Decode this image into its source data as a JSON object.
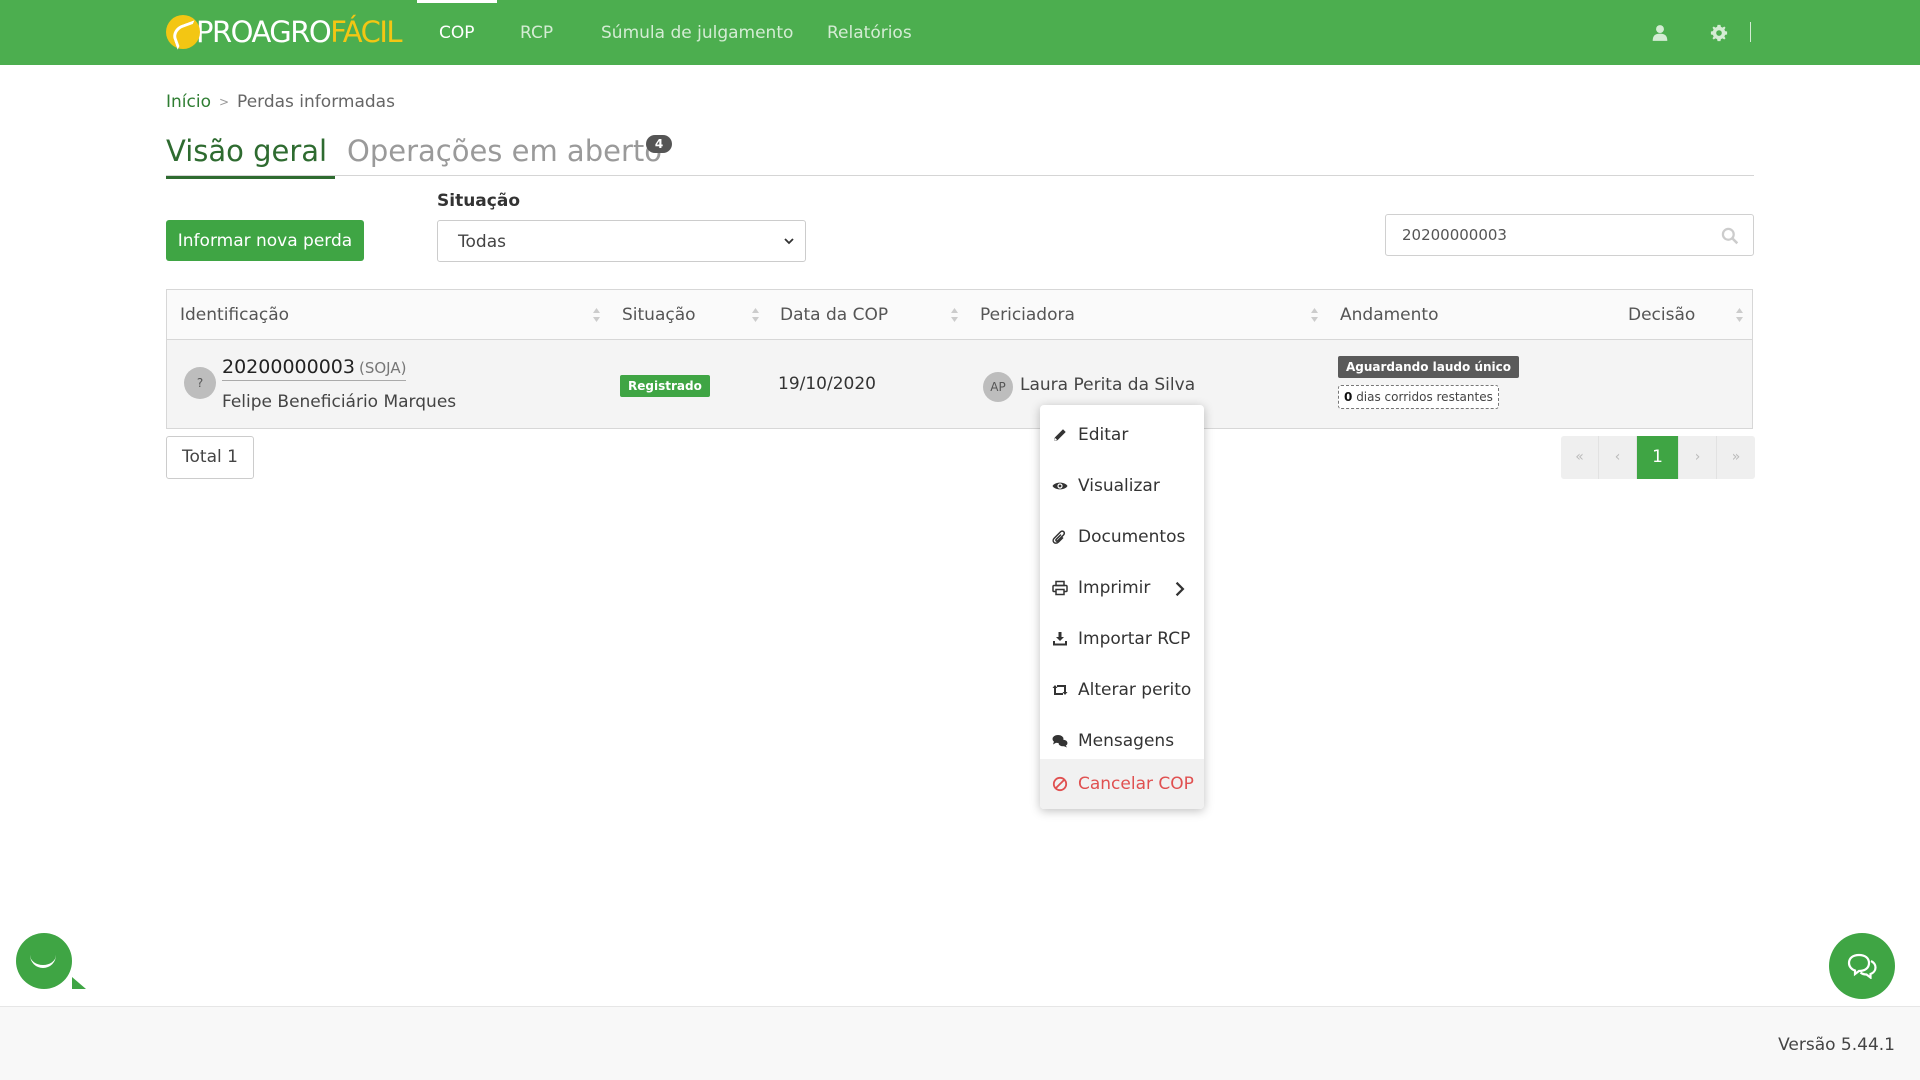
{
  "app": {
    "logo_part1": "PROAGRO",
    "logo_part2": "FÁCIL",
    "brand_color": "#4cae4f",
    "accent_color": "#f3c613"
  },
  "nav": {
    "items": [
      {
        "label": "COP",
        "active": true
      },
      {
        "label": "RCP",
        "active": false
      },
      {
        "label": "Súmula de julgamento",
        "active": false
      },
      {
        "label": "Relatórios",
        "active": false
      }
    ],
    "icons": [
      "user-icon",
      "gear-icon"
    ]
  },
  "breadcrumb": {
    "home": "Início",
    "current": "Perdas informadas"
  },
  "tabs": {
    "overview": "Visão geral",
    "open_ops": "Operações em aberto",
    "open_ops_count": "4"
  },
  "filters": {
    "new_button": "Informar nova perda",
    "status_label": "Situação",
    "status_value": "Todas",
    "search_value": "20200000003"
  },
  "table": {
    "headers": [
      "Identificação",
      "Situação",
      "Data da COP",
      "Periciadora",
      "Andamento",
      "Decisão"
    ],
    "row": {
      "avatar": "?",
      "id": "20200000003",
      "crop": "(SOJA)",
      "beneficiary": "Felipe Beneficiário Marques",
      "status": "Registrado",
      "date": "19/10/2020",
      "perito_initials": "AP",
      "perito": "Laura Perita da Silva",
      "progress": "Aguardando laudo único",
      "days_count": "0",
      "days_text": "dias corridos restantes"
    }
  },
  "total": "Total 1",
  "pagination": {
    "first": "«",
    "prev": "‹",
    "current": "1",
    "next": "›",
    "last": "»"
  },
  "context_menu": {
    "items": [
      {
        "label": "Editar",
        "icon": "pencil-icon"
      },
      {
        "label": "Visualizar",
        "icon": "eye-icon"
      },
      {
        "label": "Documentos",
        "icon": "paperclip-icon"
      },
      {
        "label": "Imprimir",
        "icon": "printer-icon"
      },
      {
        "label": "Importar RCP",
        "icon": "download-icon"
      },
      {
        "label": "Alterar perito",
        "icon": "retweet-icon"
      },
      {
        "label": "Mensagens",
        "icon": "comments-icon"
      },
      {
        "label": "Cancelar COP",
        "icon": "ban-icon"
      }
    ]
  },
  "footer": {
    "version": "Versão 5.44.1"
  }
}
